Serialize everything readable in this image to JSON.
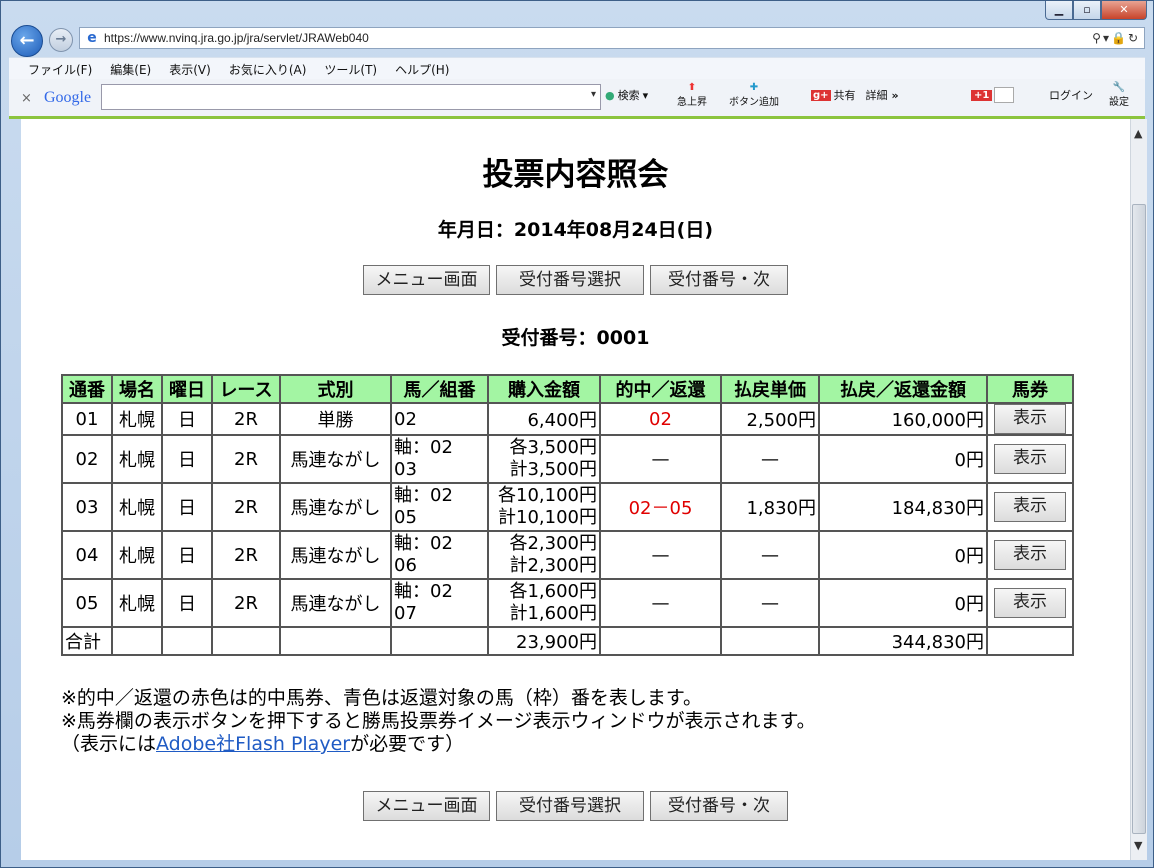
{
  "browser": {
    "url": "https://www.nvinq.jra.go.jp/jra/servlet/JRAWeb040",
    "menu": [
      "ファイル(F)",
      "編集(E)",
      "表示(V)",
      "お気に入り(A)",
      "ツール(T)",
      "ヘルプ(H)"
    ],
    "google": {
      "logo": "Google",
      "search": "検索",
      "trending": "急上昇",
      "add_button": "ボタン追加",
      "share": "共有",
      "detail": "詳細",
      "more": "»",
      "gplus": "+1",
      "login": "ログイン",
      "settings": "設定"
    }
  },
  "page": {
    "title": "投票内容照会",
    "date": "年月日：2014年08月24日(日)",
    "receipt": "受付番号：0001",
    "buttons": {
      "menu": "メニュー画面",
      "select": "受付番号選択",
      "next": "受付番号・次"
    },
    "table": {
      "headers": [
        "通番",
        "場名",
        "曜日",
        "レース",
        "式別",
        "馬／組番",
        "購入金額",
        "的中／返還",
        "払戻単価",
        "払戻／返還金額",
        "馬券"
      ],
      "rows": [
        {
          "no": "01",
          "place": "札幌",
          "day": "日",
          "race": "2R",
          "type": "単勝",
          "combo1": "02",
          "combo2": "",
          "amount1": "6,400円",
          "amount2": "",
          "hit": "02",
          "unit": "2,500円",
          "payout": "160,000円",
          "ticket": "表示"
        },
        {
          "no": "02",
          "place": "札幌",
          "day": "日",
          "race": "2R",
          "type": "馬連ながし",
          "combo1": "軸：02",
          "combo2": "03",
          "amount1": "各3,500円",
          "amount2": "計3,500円",
          "hit": "—",
          "unit": "—",
          "payout": "0円",
          "ticket": "表示"
        },
        {
          "no": "03",
          "place": "札幌",
          "day": "日",
          "race": "2R",
          "type": "馬連ながし",
          "combo1": "軸：02",
          "combo2": "05",
          "amount1": "各10,100円",
          "amount2": "計10,100円",
          "hit": "02－05",
          "unit": "1,830円",
          "payout": "184,830円",
          "ticket": "表示"
        },
        {
          "no": "04",
          "place": "札幌",
          "day": "日",
          "race": "2R",
          "type": "馬連ながし",
          "combo1": "軸：02",
          "combo2": "06",
          "amount1": "各2,300円",
          "amount2": "計2,300円",
          "hit": "—",
          "unit": "—",
          "payout": "0円",
          "ticket": "表示"
        },
        {
          "no": "05",
          "place": "札幌",
          "day": "日",
          "race": "2R",
          "type": "馬連ながし",
          "combo1": "軸：02",
          "combo2": "07",
          "amount1": "各1,600円",
          "amount2": "計1,600円",
          "hit": "—",
          "unit": "—",
          "payout": "0円",
          "ticket": "表示"
        }
      ],
      "total": {
        "label": "合計",
        "amount": "23,900円",
        "payout": "344,830円"
      }
    },
    "notes": {
      "line1": "※的中／返還の赤色は的中馬券、青色は返還対象の馬（枠）番を表します。",
      "line2": "※馬券欄の表示ボタンを押下すると勝馬投票券イメージ表示ウィンドウが表示されます。",
      "line3_pre": "（表示には",
      "link": "Adobe社Flash Player",
      "line3_post": "が必要です）"
    }
  }
}
